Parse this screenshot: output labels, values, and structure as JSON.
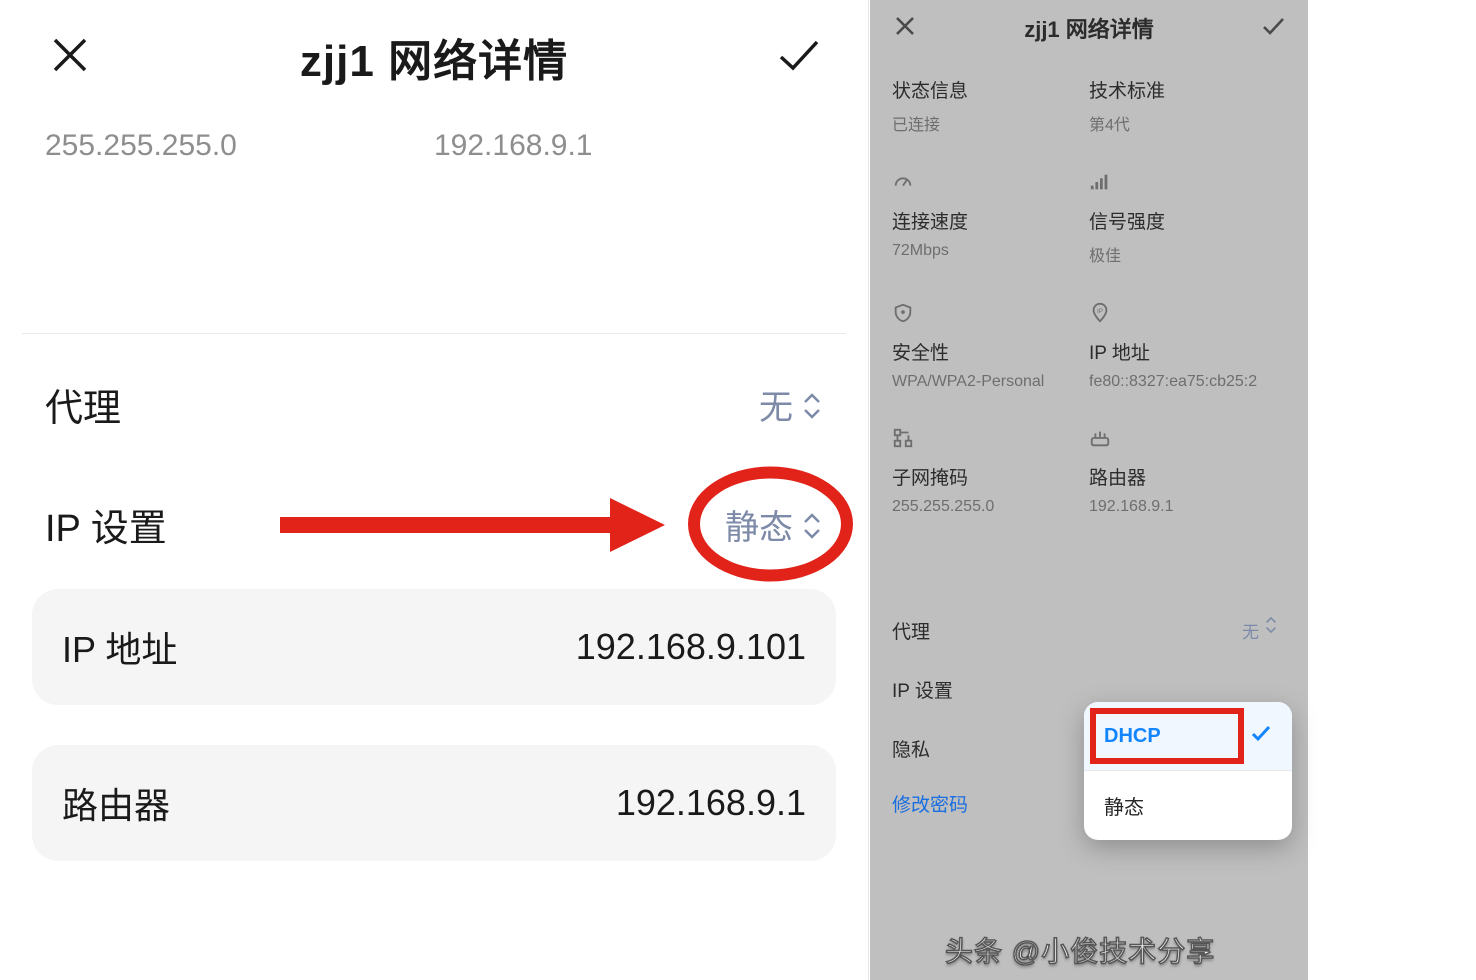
{
  "left": {
    "title": "zjj1 网络详情",
    "subnet_mask": "255.255.255.0",
    "router_top": "192.168.9.1",
    "proxy": {
      "label": "代理",
      "value": "无"
    },
    "ip_settings": {
      "label": "IP 设置",
      "value": "静态"
    },
    "ip_address": {
      "label": "IP 地址",
      "value": "192.168.9.101"
    },
    "router": {
      "label": "路由器",
      "value": "192.168.9.1"
    }
  },
  "right": {
    "title": "zjj1 网络详情",
    "status": {
      "label": "状态信息",
      "value": "已连接"
    },
    "standard": {
      "label": "技术标准",
      "value": "第4代"
    },
    "speed": {
      "label": "连接速度",
      "value": "72Mbps"
    },
    "signal": {
      "label": "信号强度",
      "value": "极佳"
    },
    "security": {
      "label": "安全性",
      "value": "WPA/WPA2-Personal"
    },
    "ip": {
      "label": "IP 地址",
      "value": "fe80::8327:ea75:cb25:2"
    },
    "subnet": {
      "label": "子网掩码",
      "value": "255.255.255.0"
    },
    "router": {
      "label": "路由器",
      "value": "192.168.9.1"
    },
    "proxy": {
      "label": "代理",
      "value": "无"
    },
    "ip_settings": {
      "label": "IP 设置"
    },
    "privacy": {
      "label": "隐私"
    },
    "change_pw": "修改密码",
    "dropdown": {
      "dhcp": "DHCP",
      "static": "静态"
    }
  },
  "watermark": "头条 @小俊技术分享"
}
